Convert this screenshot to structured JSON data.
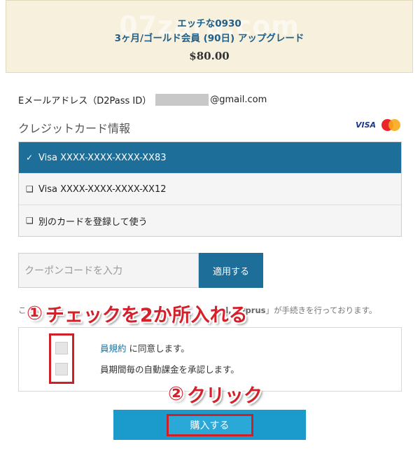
{
  "product": {
    "title": "エッチな0930",
    "subtitle": "3ヶ月/ゴールド会員 (90日) アップグレード",
    "price": "$80.00",
    "watermark": "07zara.com"
  },
  "email": {
    "label": "Eメールアドレス（D2Pass ID）",
    "domain": "@gmail.com"
  },
  "credit_card": {
    "header": "クレジットカード情報",
    "visa_logo": "VISA",
    "options": [
      {
        "mark": "✓",
        "label": "Visa XXXX-XXXX-XXXX-XX83",
        "selected": true
      },
      {
        "mark": "❑",
        "label": "Visa XXXX-XXXX-XXXX-XX12",
        "selected": false
      },
      {
        "mark": "❑",
        "label": "別のカードを登録して使う",
        "selected": false
      }
    ]
  },
  "coupon": {
    "placeholder": "クーポンコードを入力",
    "apply_label": "適用する"
  },
  "notice": {
    "lead": "こ",
    "bold_part": "d, Cyprus",
    "tail_suffix": "」が手続きを行っております。"
  },
  "agreements": {
    "row1_link": "員規約",
    "row1_text": " に同意します。",
    "row2_text": "員期間毎の自動課金を承認します。"
  },
  "callouts": {
    "step1_num": "①",
    "step1_text": "チェックを2か所入れる",
    "step2_num": "②",
    "step2_text": "クリック"
  },
  "buy_button_label": "購入する",
  "colors": {
    "accent": "#1e6e9a",
    "buy_button": "#1a9bcc",
    "annotation_red": "#d3202a",
    "product_bg": "#f6f0dc"
  }
}
